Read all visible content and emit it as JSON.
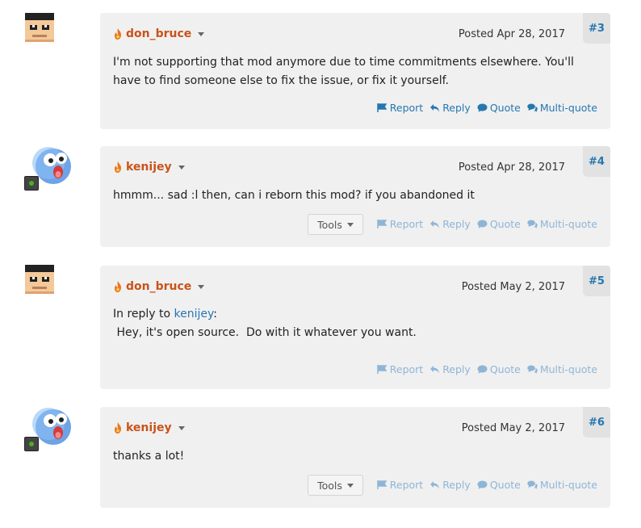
{
  "posts": [
    {
      "author": "don_bruce",
      "date": "Posted Apr 28, 2017",
      "number": "#3",
      "avatar": "pixel-face",
      "body_lines": [
        "I'm not supporting that mod anymore due to time commitments elsewhere.  You'll",
        "have to find someone else to fix the issue, or fix it yourself."
      ],
      "actions": [
        "Report",
        "Reply",
        "Quote",
        "Multi-quote"
      ]
    },
    {
      "author": "kenijey",
      "date": "Posted Apr 28, 2017",
      "number": "#4",
      "avatar": "blue-ball",
      "body_lines": [
        "hmmm... sad :l then, can i reborn this mod? if you abandoned it"
      ],
      "tools": "Tools",
      "actions": [
        "Report",
        "Reply",
        "Quote",
        "Multi-quote"
      ]
    },
    {
      "author": "don_bruce",
      "date": "Posted May 2, 2017",
      "number": "#5",
      "avatar": "pixel-face",
      "reply_prefix": "In reply to ",
      "reply_user": "kenijey",
      "reply_suffix": ":",
      "body_lines": [
        " Hey, it's open source.  Do with it whatever you want."
      ],
      "actions": [
        "Report",
        "Reply",
        "Quote",
        "Multi-quote"
      ]
    },
    {
      "author": "kenijey",
      "date": "Posted May 2, 2017",
      "number": "#6",
      "avatar": "blue-ball",
      "body_lines": [
        "thanks a lot!"
      ],
      "tools": "Tools",
      "actions": [
        "Report",
        "Reply",
        "Quote",
        "Multi-quote"
      ]
    }
  ],
  "colors": {
    "author": "#c9531a",
    "link": "#2577b1",
    "card": "#f0f0f0",
    "online": "#4caf1a"
  }
}
